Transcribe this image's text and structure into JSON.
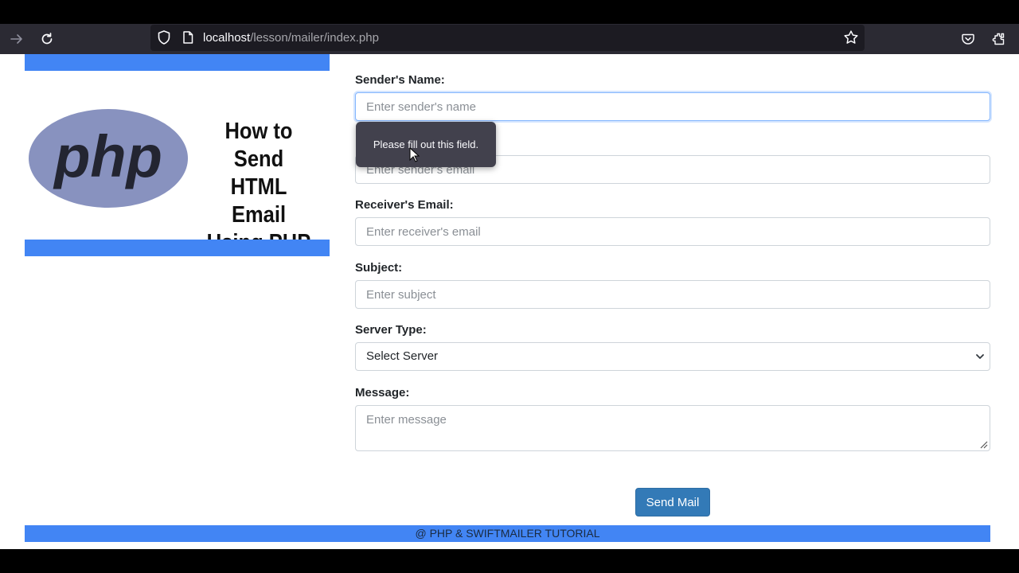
{
  "browser": {
    "url_host": "localhost",
    "url_path": "/lesson/mailer/index.php",
    "icons": [
      "forward-icon",
      "reload-icon",
      "shield-icon",
      "page-icon",
      "bookmark-star-icon",
      "pocket-icon",
      "extensions-icon"
    ]
  },
  "hero": {
    "logo_text": "php",
    "title_line1": "How to Send",
    "title_line2": "HTML Email",
    "title_line3": "Using PHP"
  },
  "form": {
    "sender_name_label": "Sender's Name:",
    "sender_name_placeholder": "Enter sender's name",
    "sender_email_placeholder": "Enter sender's email",
    "receiver_email_label": "Receiver's Email:",
    "receiver_email_placeholder": "Enter receiver's email",
    "subject_label": "Subject:",
    "subject_placeholder": "Enter subject",
    "server_type_label": "Server Type:",
    "server_type_selected": "Select Server",
    "message_label": "Message:",
    "message_placeholder": "Enter message",
    "submit_label": "Send Mail"
  },
  "tooltip": {
    "text": "Please fill out this field."
  },
  "footer": {
    "text": "@ PHP & SWIFTMAILER TUTORIAL"
  },
  "colors": {
    "accent_bar": "#4285f4",
    "button": "#337ab7",
    "php_logo": "#8892bf",
    "browser_toolbar": "#2b2a33"
  }
}
